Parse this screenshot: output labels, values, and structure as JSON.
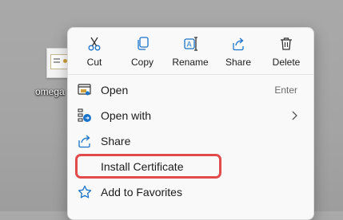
{
  "desktop": {
    "file_label": "omega"
  },
  "context_menu": {
    "quick_actions": [
      {
        "label": "Cut",
        "icon": "scissors-icon"
      },
      {
        "label": "Copy",
        "icon": "copy-icon"
      },
      {
        "label": "Rename",
        "icon": "rename-icon"
      },
      {
        "label": "Share",
        "icon": "share-icon"
      },
      {
        "label": "Delete",
        "icon": "trash-icon"
      }
    ],
    "items": [
      {
        "label": "Open",
        "shortcut": "Enter",
        "icon": "open-icon"
      },
      {
        "label": "Open with",
        "icon": "open-with-icon",
        "has_submenu": true
      },
      {
        "label": "Share",
        "icon": "share-icon"
      },
      {
        "label": "Install Certificate",
        "highlighted": true
      },
      {
        "label": "Add to Favorites",
        "icon": "star-icon"
      }
    ]
  },
  "colors": {
    "accent": "#1a73c9",
    "highlight_outline": "#e14b4b",
    "menu_background": "#f9f9f9",
    "desktop_background": "#a6a6a6"
  }
}
